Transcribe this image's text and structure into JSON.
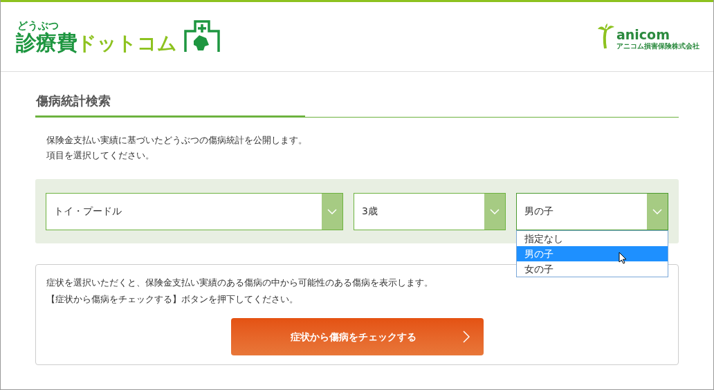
{
  "header": {
    "logo": {
      "kana": "どうぶつ",
      "main": "診療費",
      "accent": "ドットコム"
    },
    "partner": {
      "name": "anicom",
      "company": "アニコム損害保険株式会社"
    }
  },
  "section": {
    "title": "傷病統計検索",
    "intro": [
      "保険金支払い実績に基づいたどうぶつの傷病統計を公開します。",
      "項目を選択してください。"
    ]
  },
  "selects": [
    {
      "value": "トイ・プードル",
      "expanded": false
    },
    {
      "value": "3歳",
      "expanded": false
    },
    {
      "value": "男の子",
      "expanded": true,
      "options": [
        {
          "label": "指定なし",
          "selected": false
        },
        {
          "label": "男の子",
          "selected": true
        },
        {
          "label": "女の子",
          "selected": false
        }
      ]
    }
  ],
  "symptom": {
    "lines": [
      "症状を選択いただくと、保険金支払い実績のある傷病の中から可能性のある傷病を表示します。",
      "【症状から傷病をチェックする】ボタンを押下してください。"
    ],
    "button": "症状から傷病をチェックする"
  }
}
